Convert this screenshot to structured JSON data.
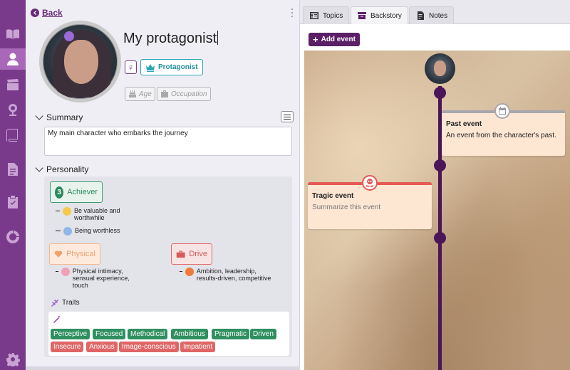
{
  "nav": {
    "back_label": "Back",
    "rail_items": [
      "book-icon",
      "user-icon",
      "clapperboard-icon",
      "map-pin-icon",
      "books-icon",
      "document-icon",
      "clipboard-check-icon",
      "chart-donut-icon",
      "settings-icon"
    ],
    "active_rail": "user-icon"
  },
  "character": {
    "name": "My protagonist",
    "gender_symbol": "♀",
    "role_label": "Protagonist",
    "age_placeholder": "Age",
    "occupation_placeholder": "Occupation"
  },
  "summary": {
    "heading": "Summary",
    "text": "My main character who embarks the journey"
  },
  "personality": {
    "heading": "Personality",
    "enneagram": {
      "number": "3",
      "label": "Achiever",
      "items": [
        "Be valuable and worthwhile",
        "Being worthless"
      ]
    },
    "love_language": {
      "label": "Physical",
      "item": "Physical intimacy, sensual experience, touch"
    },
    "motivation": {
      "label": "Drive",
      "item": "Ambition, leadership, results-driven, competitive"
    },
    "traits_heading": "Traits",
    "positive_traits": [
      "Perceptive",
      "Focused",
      "Methodical",
      "Ambitious",
      "Pragmatic",
      "Driven"
    ],
    "negative_traits": [
      "Insecure",
      "Anxious",
      "Image-conscious",
      "Impatient"
    ]
  },
  "tabs": [
    "Topics",
    "Backstory",
    "Notes"
  ],
  "active_tab": "Backstory",
  "backstory": {
    "add_event_label": "Add event",
    "events": [
      {
        "title": "Past event",
        "description": "An event from the character's past.",
        "accent": "#a9a7ae",
        "icon": "calendar-icon"
      },
      {
        "title": "Tragic event",
        "description": "Summarize this event",
        "accent": "#e55a55",
        "icon": "skull-crossbones-icon"
      }
    ]
  },
  "colors": {
    "rail": "#7a3a8c",
    "rail_active": "#a867b8",
    "timeline": "#4a1658",
    "role_teal": "#2aa9b1",
    "trait_positive": "#2f8f5f",
    "trait_negative": "#e06565"
  }
}
